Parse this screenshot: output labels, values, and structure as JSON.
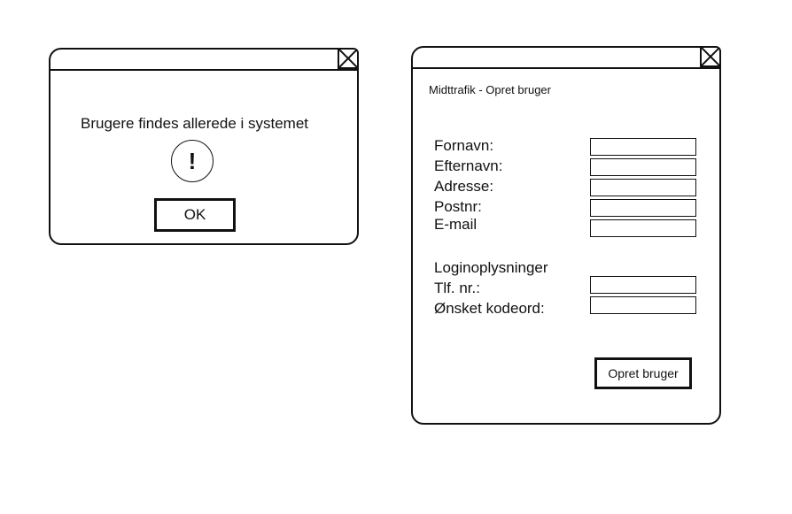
{
  "dialog": {
    "message": "Brugere findes allerede i systemet",
    "warning_glyph": "!",
    "ok_label": "OK"
  },
  "form": {
    "title": "Midttrafik - Opret bruger",
    "fields": {
      "fornavn": {
        "label": "Fornavn:",
        "value": "",
        "placeholder": ""
      },
      "efternavn": {
        "label": "Efternavn:",
        "value": "",
        "placeholder": ""
      },
      "adresse": {
        "label": "Adresse:",
        "value": "",
        "placeholder": ""
      },
      "postnr": {
        "label": "Postnr:",
        "value": "",
        "placeholder": ""
      },
      "email": {
        "label": "E-mail",
        "value": "",
        "placeholder": ""
      },
      "tlf": {
        "label": "Tlf. nr.:",
        "value": "",
        "placeholder": ""
      },
      "kodeord": {
        "label": "Ønsket kodeord:",
        "value": "",
        "placeholder": ""
      }
    },
    "login_section_label": "Loginoplysninger",
    "submit_label": "Opret bruger"
  },
  "icons": {
    "window_close": "close-x-icon",
    "warning": "exclamation-icon"
  },
  "colors": {
    "stroke": "#111111",
    "background": "#ffffff"
  }
}
